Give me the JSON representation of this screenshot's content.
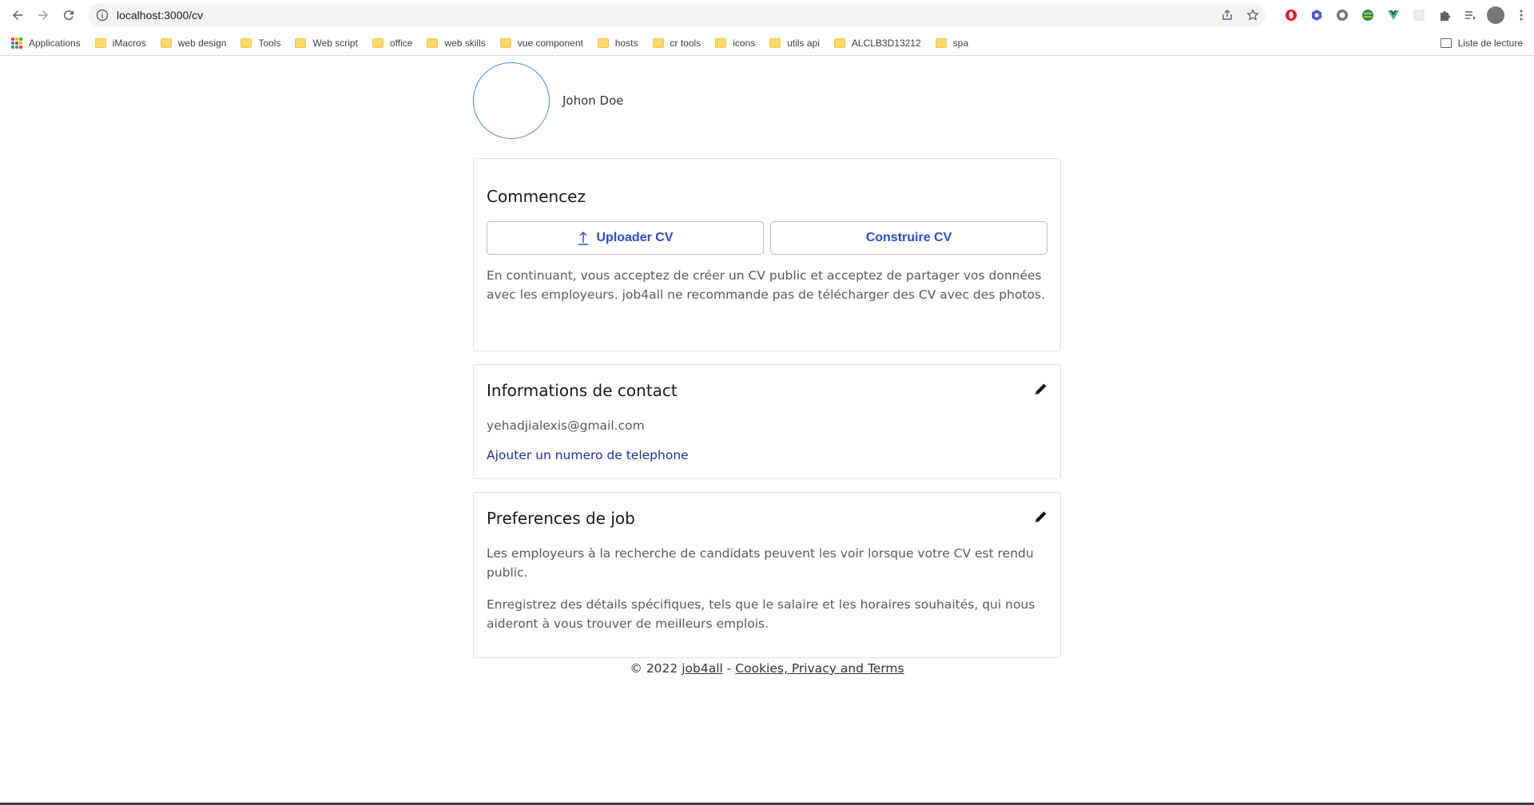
{
  "browser": {
    "url": "localhost:3000/cv",
    "bookmarks": [
      {
        "label": "Applications"
      },
      {
        "label": "iMacros"
      },
      {
        "label": "web design"
      },
      {
        "label": "Tools"
      },
      {
        "label": "Web script"
      },
      {
        "label": "office"
      },
      {
        "label": "web skills"
      },
      {
        "label": "vue component"
      },
      {
        "label": "hosts"
      },
      {
        "label": "cr tools"
      },
      {
        "label": "icons"
      },
      {
        "label": "utils api"
      },
      {
        "label": "ALCLB3D13212"
      },
      {
        "label": "spa"
      }
    ],
    "reading_list": "Liste de lecture"
  },
  "profile": {
    "name": "Johon Doe"
  },
  "start": {
    "title": "Commencez",
    "upload_label": "Uploader CV",
    "build_label": "Construire CV",
    "notice": "En continuant, vous acceptez de créer un CV public et acceptez de partager vos données avec les employeurs. job4all ne recommande pas de télécharger des CV avec des photos."
  },
  "contact": {
    "title": "Informations de contact",
    "email": "yehadjialexis@gmail.com",
    "add_phone": "Ajouter un numero de telephone"
  },
  "prefs": {
    "title": "Preferences de job",
    "p1": "Les employeurs à la recherche de candidats peuvent les voir lorsque votre CV est rendu public.",
    "p2": "Enregistrez des détails spécifiques, tels que le salaire et les horaires souhaités, qui nous aideront à vous trouver de meilleurs emplois."
  },
  "footer": {
    "copyright": "© 2022",
    "brand": "job4all",
    "sep": "-",
    "terms": "Cookies, Privacy and Terms"
  },
  "colors": {
    "accent": "#2c4bd1",
    "link": "#1f2f9e",
    "photo_border": "#4a86e8"
  }
}
